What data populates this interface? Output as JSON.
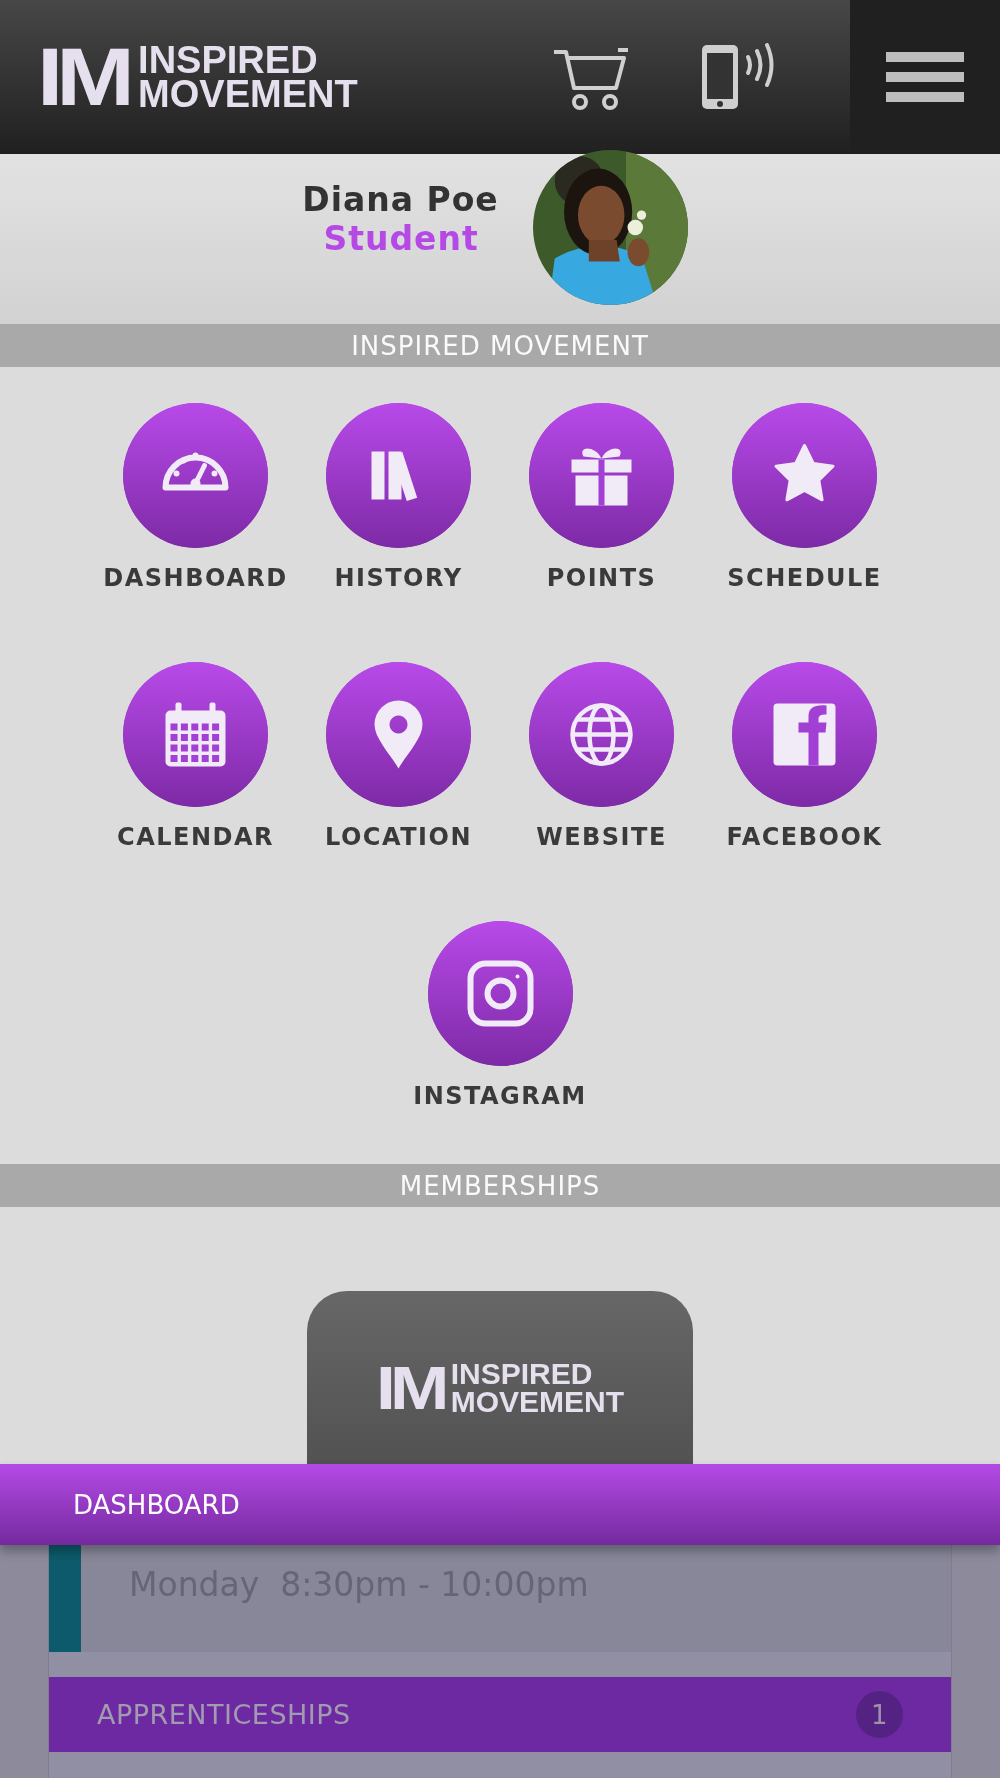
{
  "header": {
    "logo": {
      "mark": "IM",
      "line1": "INSPIRED",
      "line2": "MOVEMENT"
    }
  },
  "profile": {
    "name": "Diana Poe",
    "role": "Student"
  },
  "sections": [
    {
      "title": "INSPIRED MOVEMENT"
    },
    {
      "title": "MEMBERSHIPS"
    }
  ],
  "shortcuts": [
    {
      "kind": "dashboard",
      "label": "DASHBOARD"
    },
    {
      "kind": "history",
      "label": "HISTORY"
    },
    {
      "kind": "points",
      "label": "POINTS"
    },
    {
      "kind": "schedule",
      "label": "SCHEDULE"
    },
    {
      "kind": "calendar",
      "label": "CALENDAR"
    },
    {
      "kind": "location",
      "label": "LOCATION"
    },
    {
      "kind": "website",
      "label": "WEBSITE"
    },
    {
      "kind": "facebook",
      "label": "FACEBOOK"
    },
    {
      "kind": "instagram",
      "label": "INSTAGRAM"
    }
  ],
  "membership_card": {
    "logo": {
      "mark": "IM",
      "line1": "INSPIRED",
      "line2": "MOVEMENT"
    }
  },
  "bottom_bar": {
    "title": "DASHBOARD"
  },
  "dashboard_panel": {
    "class_time": "Monday  8:30pm - 10:00pm",
    "apprenticeships": {
      "label": "APPRENTICESHIPS",
      "count": "1"
    }
  }
}
